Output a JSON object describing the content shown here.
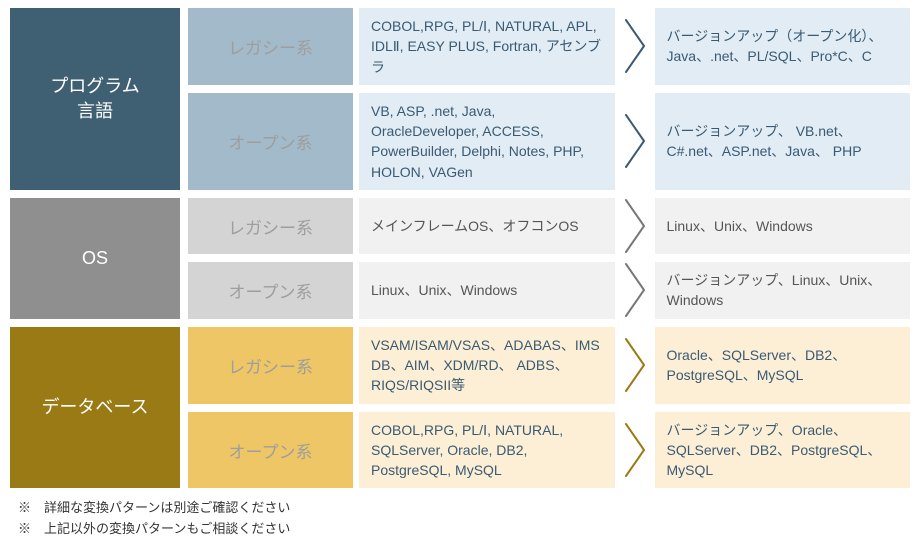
{
  "categories": [
    {
      "id": "prog",
      "label": "プログラム\n言語",
      "theme": "c-prog",
      "arrow_color": "#3a5a73",
      "rows": [
        {
          "sub": "レガシー系",
          "from": "COBOL,RPG, PL/Ⅰ, NATURAL, APL, IDLⅡ, EASY PLUS, Fortran, アセンブラ",
          "to": "バージョンアップ（オープン化）、Java、.net、PL/SQL、Pro*C、C"
        },
        {
          "sub": "オープン系",
          "from": "VB, ASP, .net, Java, OracleDeveloper, ACCESS, PowerBuilder, Delphi, Notes, PHP, HOLON, VAGen",
          "to": "バージョンアップ、 VB.net、C#.net、ASP.net、Java、 PHP"
        }
      ]
    },
    {
      "id": "os",
      "label": "OS",
      "theme": "c-os",
      "arrow_color": "#777",
      "rows": [
        {
          "sub": "レガシー系",
          "from": "メインフレームOS、オフコンOS",
          "to": "Linux、Unix、Windows"
        },
        {
          "sub": "オープン系",
          "from": "Linux、Unix、Windows",
          "to": "バージョンアップ、Linux、Unix、Windows"
        }
      ]
    },
    {
      "id": "db",
      "label": "データベース",
      "theme": "c-db",
      "arrow_color": "#9a7a14",
      "rows": [
        {
          "sub": "レガシー系",
          "from": "VSAM/ISAM/VSAS、ADABAS、IMS DB、AIM、XDM/RD、 ADBS、RIQS/RIQSII等",
          "to": "Oracle、SQLServer、DB2、PostgreSQL、MySQL"
        },
        {
          "sub": "オープン系",
          "from": "COBOL,RPG, PL/Ⅰ, NATURAL, SQLServer, Oracle, DB2, PostgreSQL, MySQL",
          "to": "バージョンアップ、Oracle、SQLServer、DB2、PostgreSQL、MySQL"
        }
      ]
    }
  ],
  "notes": [
    "※　詳細な変換パターンは別途ご確認ください",
    "※　上記以外の変換パターンもご相談ください"
  ]
}
